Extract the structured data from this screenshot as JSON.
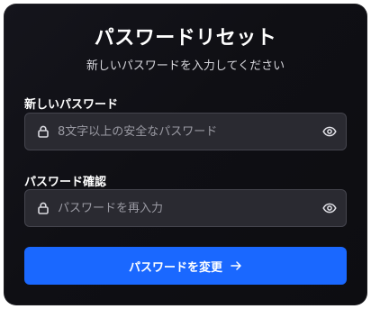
{
  "header": {
    "title": "パスワードリセット",
    "subtitle": "新しいパスワードを入力してください"
  },
  "form": {
    "new_password": {
      "label": "新しいパスワード",
      "placeholder": "8文字以上の安全なパスワード",
      "value": ""
    },
    "confirm_password": {
      "label": "パスワード確認",
      "placeholder": "パスワードを再入力",
      "value": ""
    },
    "submit_label": "パスワードを変更"
  },
  "colors": {
    "background": "#0f0f14",
    "field_bg": "#2a2a31",
    "accent": "#1a68ff"
  },
  "icons": {
    "field_leading": "lock-icon",
    "field_trailing": "eye-icon",
    "submit_trailing": "arrow-right-icon"
  }
}
